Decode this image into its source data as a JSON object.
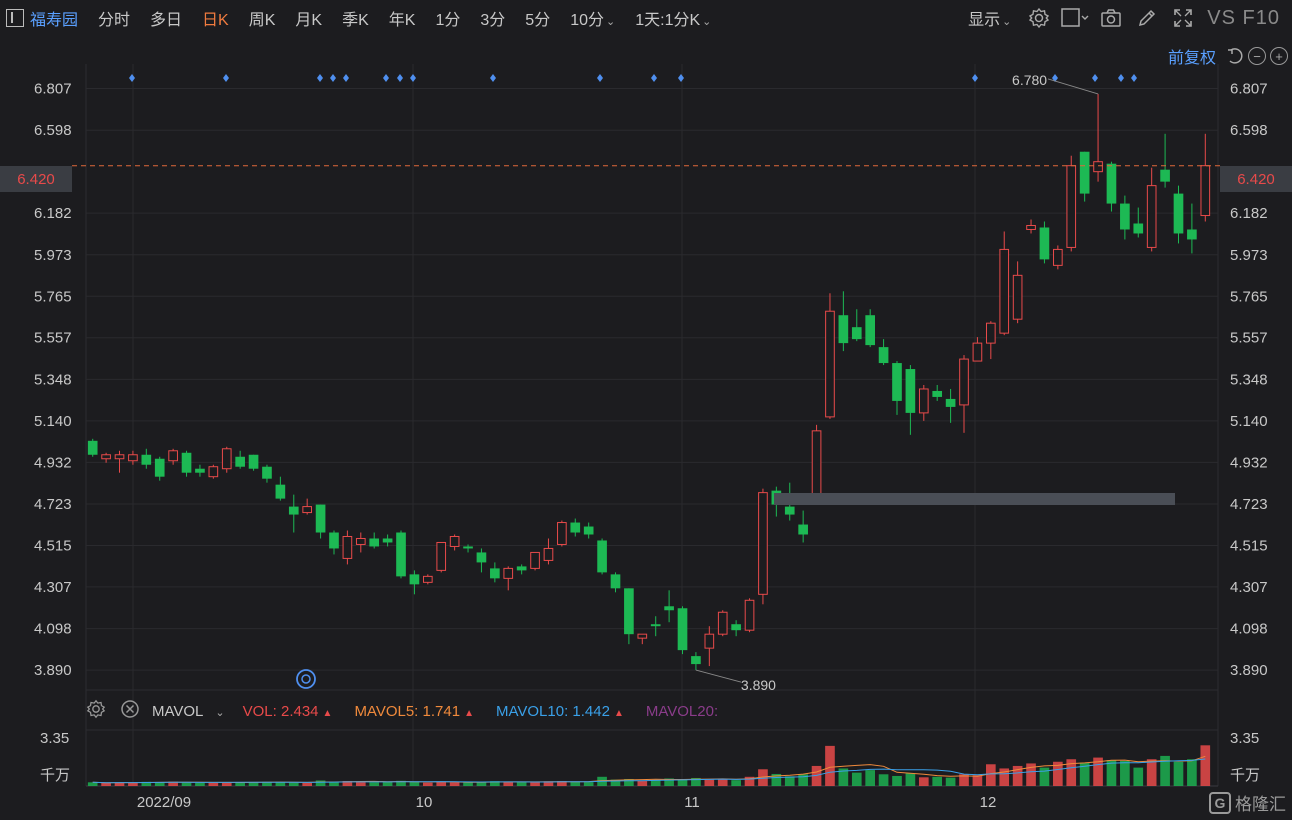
{
  "toolbar": {
    "stock_name": "福寿园",
    "periods": [
      "分时",
      "多日",
      "日K",
      "周K",
      "月K",
      "季K",
      "年K",
      "1分",
      "3分",
      "5分",
      "10分"
    ],
    "active_period": "日K",
    "more_period": "1天:1分K",
    "display_label": "显示",
    "vs_f10": "VS F10",
    "icons": [
      "settings-icon",
      "square-icon",
      "camera-icon",
      "pencil-icon",
      "fullscreen-icon"
    ]
  },
  "adjust": {
    "label": "前复权",
    "icons": [
      "undo-icon",
      "minus-icon",
      "plus-icon"
    ]
  },
  "price_axis": {
    "ticks": [
      "6.807",
      "6.598",
      "6.182",
      "5.973",
      "5.765",
      "5.557",
      "5.348",
      "5.140",
      "4.932",
      "4.723",
      "4.515",
      "4.307",
      "4.098",
      "3.890"
    ],
    "current_price": "6.420",
    "current_color": "#e84a4a"
  },
  "annotations": {
    "high": "6.780",
    "low": "3.890"
  },
  "x_axis": {
    "labels": [
      "2022/09",
      "10",
      "11",
      "12"
    ]
  },
  "volume": {
    "indicator": "MAVOL",
    "vol_label": "VOL:",
    "vol_value": "2.434",
    "mavol5_label": "MAVOL5:",
    "mavol5_value": "1.741",
    "mavol10_label": "MAVOL10:",
    "mavol10_value": "1.442",
    "mavol20_label": "MAVOL20:",
    "axis_max": "3.35",
    "unit": "千万",
    "colors": {
      "vol": "#e84a4a",
      "mavol5": "#f08a3c",
      "mavol10": "#3aa0e8",
      "mavol20": "#8a3c8a"
    }
  },
  "watermark": "格隆汇",
  "colors": {
    "up": "#e84a4a",
    "down": "#1db954",
    "accent": "#f07b3f",
    "link": "#5aa0ff"
  },
  "chart_data": {
    "type": "candlestick",
    "ylim": [
      3.79,
      6.9
    ],
    "candles": [
      {
        "o": 5.04,
        "h": 5.05,
        "l": 4.96,
        "c": 4.97
      },
      {
        "o": 4.95,
        "h": 4.98,
        "l": 4.93,
        "c": 4.97
      },
      {
        "o": 4.95,
        "h": 4.99,
        "l": 4.88,
        "c": 4.97
      },
      {
        "o": 4.94,
        "h": 4.99,
        "l": 4.92,
        "c": 4.97
      },
      {
        "o": 4.97,
        "h": 5.0,
        "l": 4.9,
        "c": 4.92
      },
      {
        "o": 4.95,
        "h": 4.96,
        "l": 4.84,
        "c": 4.86
      },
      {
        "o": 4.94,
        "h": 5.0,
        "l": 4.92,
        "c": 4.99
      },
      {
        "o": 4.98,
        "h": 4.99,
        "l": 4.86,
        "c": 4.88
      },
      {
        "o": 4.9,
        "h": 4.92,
        "l": 4.86,
        "c": 4.88
      },
      {
        "o": 4.86,
        "h": 4.92,
        "l": 4.85,
        "c": 4.91
      },
      {
        "o": 4.9,
        "h": 5.01,
        "l": 4.88,
        "c": 5.0
      },
      {
        "o": 4.96,
        "h": 4.99,
        "l": 4.9,
        "c": 4.91
      },
      {
        "o": 4.97,
        "h": 4.97,
        "l": 4.89,
        "c": 4.9
      },
      {
        "o": 4.91,
        "h": 4.92,
        "l": 4.83,
        "c": 4.85
      },
      {
        "o": 4.82,
        "h": 4.86,
        "l": 4.74,
        "c": 4.75
      },
      {
        "o": 4.71,
        "h": 4.77,
        "l": 4.58,
        "c": 4.67
      },
      {
        "o": 4.68,
        "h": 4.75,
        "l": 4.67,
        "c": 4.71
      },
      {
        "o": 4.72,
        "h": 4.72,
        "l": 4.55,
        "c": 4.58
      },
      {
        "o": 4.58,
        "h": 4.59,
        "l": 4.47,
        "c": 4.5
      },
      {
        "o": 4.45,
        "h": 4.59,
        "l": 4.42,
        "c": 4.56
      },
      {
        "o": 4.52,
        "h": 4.58,
        "l": 4.48,
        "c": 4.55
      },
      {
        "o": 4.55,
        "h": 4.58,
        "l": 4.5,
        "c": 4.51
      },
      {
        "o": 4.55,
        "h": 4.57,
        "l": 4.51,
        "c": 4.53
      },
      {
        "o": 4.58,
        "h": 4.59,
        "l": 4.35,
        "c": 4.36
      },
      {
        "o": 4.37,
        "h": 4.39,
        "l": 4.27,
        "c": 4.32
      },
      {
        "o": 4.33,
        "h": 4.37,
        "l": 4.32,
        "c": 4.36
      },
      {
        "o": 4.39,
        "h": 4.53,
        "l": 4.38,
        "c": 4.53
      },
      {
        "o": 4.51,
        "h": 4.57,
        "l": 4.49,
        "c": 4.56
      },
      {
        "o": 4.51,
        "h": 4.52,
        "l": 4.48,
        "c": 4.5
      },
      {
        "o": 4.48,
        "h": 4.5,
        "l": 4.38,
        "c": 4.43
      },
      {
        "o": 4.4,
        "h": 4.43,
        "l": 4.33,
        "c": 4.35
      },
      {
        "o": 4.35,
        "h": 4.41,
        "l": 4.29,
        "c": 4.4
      },
      {
        "o": 4.41,
        "h": 4.42,
        "l": 4.37,
        "c": 4.39
      },
      {
        "o": 4.4,
        "h": 4.48,
        "l": 4.39,
        "c": 4.48
      },
      {
        "o": 4.44,
        "h": 4.55,
        "l": 4.42,
        "c": 4.5
      },
      {
        "o": 4.52,
        "h": 4.64,
        "l": 4.51,
        "c": 4.63
      },
      {
        "o": 4.63,
        "h": 4.65,
        "l": 4.56,
        "c": 4.58
      },
      {
        "o": 4.61,
        "h": 4.63,
        "l": 4.55,
        "c": 4.57
      },
      {
        "o": 4.54,
        "h": 4.55,
        "l": 4.37,
        "c": 4.38
      },
      {
        "o": 4.37,
        "h": 4.38,
        "l": 4.28,
        "c": 4.3
      },
      {
        "o": 4.3,
        "h": 4.3,
        "l": 4.02,
        "c": 4.07
      },
      {
        "o": 4.05,
        "h": 4.06,
        "l": 4.02,
        "c": 4.07
      },
      {
        "o": 4.12,
        "h": 4.16,
        "l": 4.06,
        "c": 4.11
      },
      {
        "o": 4.21,
        "h": 4.29,
        "l": 4.13,
        "c": 4.19
      },
      {
        "o": 4.2,
        "h": 4.21,
        "l": 3.97,
        "c": 3.99
      },
      {
        "o": 3.96,
        "h": 3.98,
        "l": 3.89,
        "c": 3.92
      },
      {
        "o": 4.0,
        "h": 4.11,
        "l": 3.91,
        "c": 4.07
      },
      {
        "o": 4.07,
        "h": 4.19,
        "l": 4.06,
        "c": 4.18
      },
      {
        "o": 4.12,
        "h": 4.14,
        "l": 4.06,
        "c": 4.09
      },
      {
        "o": 4.09,
        "h": 4.25,
        "l": 4.08,
        "c": 4.24
      },
      {
        "o": 4.27,
        "h": 4.8,
        "l": 4.22,
        "c": 4.78
      },
      {
        "o": 4.79,
        "h": 4.81,
        "l": 4.66,
        "c": 4.72
      },
      {
        "o": 4.71,
        "h": 4.83,
        "l": 4.64,
        "c": 4.67
      },
      {
        "o": 4.62,
        "h": 4.69,
        "l": 4.53,
        "c": 4.57
      },
      {
        "o": 4.76,
        "h": 5.12,
        "l": 4.74,
        "c": 5.09
      },
      {
        "o": 5.16,
        "h": 5.78,
        "l": 5.15,
        "c": 5.69
      },
      {
        "o": 5.67,
        "h": 5.79,
        "l": 5.49,
        "c": 5.53
      },
      {
        "o": 5.61,
        "h": 5.7,
        "l": 5.54,
        "c": 5.55
      },
      {
        "o": 5.67,
        "h": 5.7,
        "l": 5.51,
        "c": 5.52
      },
      {
        "o": 5.51,
        "h": 5.55,
        "l": 5.42,
        "c": 5.43
      },
      {
        "o": 5.43,
        "h": 5.44,
        "l": 5.17,
        "c": 5.24
      },
      {
        "o": 5.4,
        "h": 5.42,
        "l": 5.07,
        "c": 5.18
      },
      {
        "o": 5.18,
        "h": 5.32,
        "l": 5.14,
        "c": 5.3
      },
      {
        "o": 5.29,
        "h": 5.32,
        "l": 5.24,
        "c": 5.26
      },
      {
        "o": 5.25,
        "h": 5.3,
        "l": 5.13,
        "c": 5.21
      },
      {
        "o": 5.22,
        "h": 5.47,
        "l": 5.08,
        "c": 5.45
      },
      {
        "o": 5.44,
        "h": 5.56,
        "l": 5.44,
        "c": 5.53
      },
      {
        "o": 5.53,
        "h": 5.64,
        "l": 5.45,
        "c": 5.63
      },
      {
        "o": 5.58,
        "h": 6.09,
        "l": 5.57,
        "c": 6.0
      },
      {
        "o": 5.65,
        "h": 5.94,
        "l": 5.63,
        "c": 5.87
      },
      {
        "o": 6.1,
        "h": 6.15,
        "l": 6.08,
        "c": 6.12
      },
      {
        "o": 6.11,
        "h": 6.14,
        "l": 5.93,
        "c": 5.95
      },
      {
        "o": 5.92,
        "h": 6.02,
        "l": 5.9,
        "c": 6.0
      },
      {
        "o": 6.01,
        "h": 6.47,
        "l": 5.99,
        "c": 6.42
      },
      {
        "o": 6.49,
        "h": 6.49,
        "l": 6.24,
        "c": 6.28
      },
      {
        "o": 6.39,
        "h": 6.78,
        "l": 6.34,
        "c": 6.44
      },
      {
        "o": 6.43,
        "h": 6.44,
        "l": 6.19,
        "c": 6.23
      },
      {
        "o": 6.23,
        "h": 6.27,
        "l": 6.05,
        "c": 6.1
      },
      {
        "o": 6.13,
        "h": 6.21,
        "l": 6.06,
        "c": 6.08
      },
      {
        "o": 6.01,
        "h": 6.41,
        "l": 5.99,
        "c": 6.32
      },
      {
        "o": 6.4,
        "h": 6.58,
        "l": 6.31,
        "c": 6.34
      },
      {
        "o": 6.28,
        "h": 6.32,
        "l": 6.03,
        "c": 6.08
      },
      {
        "o": 6.1,
        "h": 6.23,
        "l": 5.98,
        "c": 6.05
      },
      {
        "o": 6.17,
        "h": 6.58,
        "l": 6.14,
        "c": 6.42
      }
    ],
    "volume": [
      0.22,
      0.18,
      0.21,
      0.2,
      0.25,
      0.23,
      0.26,
      0.2,
      0.19,
      0.21,
      0.22,
      0.24,
      0.23,
      0.25,
      0.22,
      0.2,
      0.19,
      0.33,
      0.25,
      0.3,
      0.27,
      0.22,
      0.24,
      0.31,
      0.26,
      0.2,
      0.25,
      0.21,
      0.22,
      0.24,
      0.29,
      0.26,
      0.21,
      0.24,
      0.28,
      0.3,
      0.26,
      0.23,
      0.55,
      0.38,
      0.42,
      0.32,
      0.36,
      0.45,
      0.4,
      0.48,
      0.38,
      0.4,
      0.35,
      0.55,
      1.0,
      0.72,
      0.58,
      0.7,
      1.2,
      2.4,
      1.05,
      0.8,
      0.95,
      0.7,
      0.6,
      0.75,
      0.52,
      0.55,
      0.5,
      0.7,
      0.65,
      1.3,
      1.05,
      1.2,
      1.35,
      1.1,
      1.45,
      1.6,
      1.4,
      1.7,
      1.55,
      1.5,
      1.1,
      1.6,
      1.8,
      1.45,
      1.6,
      2.434
    ],
    "up_color": "#e84a4a",
    "down_color": "#1db954"
  }
}
